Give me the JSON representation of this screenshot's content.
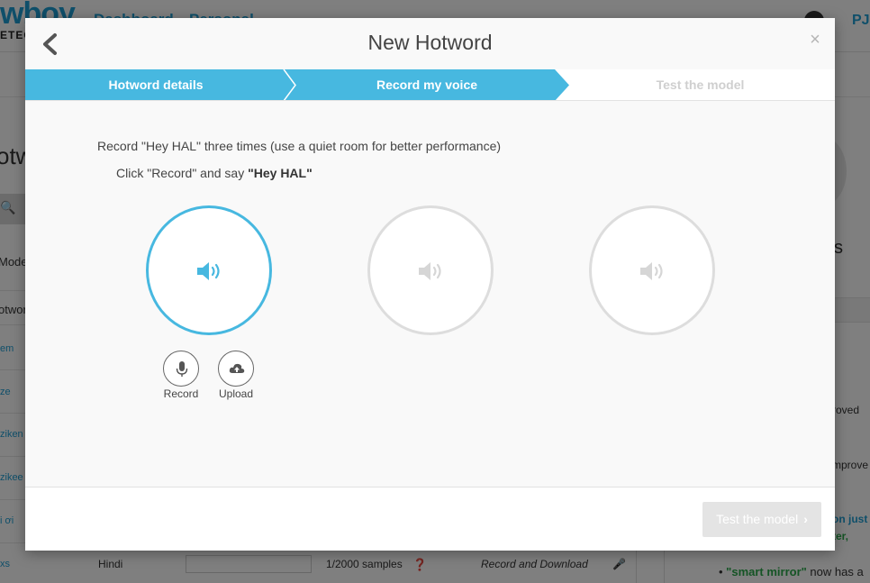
{
  "background": {
    "logo": "wboy",
    "logo_sub": "ETEC",
    "nav_item_1": "Dashboard",
    "nav_item_2": "Personal",
    "user_initials": "PJ",
    "page_title": "otw",
    "left_labels": [
      "Mode",
      "otwor"
    ],
    "left_links": [
      "em",
      "ze",
      "ziken",
      "zikee",
      "i ơi",
      "xs"
    ],
    "row_language": "Hindi",
    "row_samples": "1/2000 samples",
    "row_action": "Record and Download",
    "right_s": "s",
    "right_texts": [
      "roved",
      "mprove",
      "on just",
      "ter,"
    ],
    "right_bullet_prefix": "\"smart mirror\"",
    "right_bullet_suffix": " now has a"
  },
  "modal": {
    "title": "New Hotword",
    "close_symbol": "×",
    "steps": [
      {
        "label": "Hotword details",
        "state": "completed"
      },
      {
        "label": "Record my voice",
        "state": "active"
      },
      {
        "label": "Test the model",
        "state": "inactive"
      }
    ],
    "instruction_line1": "Record \"Hey HAL\" three times (use a quiet room for better performance)",
    "instruction_line2_prefix": "Click \"Record\" and say ",
    "instruction_line2_bold": "\"Hey HAL\"",
    "samples": [
      {
        "state": "active",
        "icon": "speaker-icon"
      },
      {
        "state": "idle",
        "icon": "speaker-icon"
      },
      {
        "state": "idle",
        "icon": "speaker-icon"
      }
    ],
    "record_label": "Record",
    "upload_label": "Upload",
    "next_button_label": "Test the model",
    "next_button_chevron": "›"
  },
  "colors": {
    "accent": "#47b8e0",
    "step_active_bg": "#47b8e0",
    "idle_circle": "#dddddd",
    "disabled_button": "#e4e4e4"
  }
}
